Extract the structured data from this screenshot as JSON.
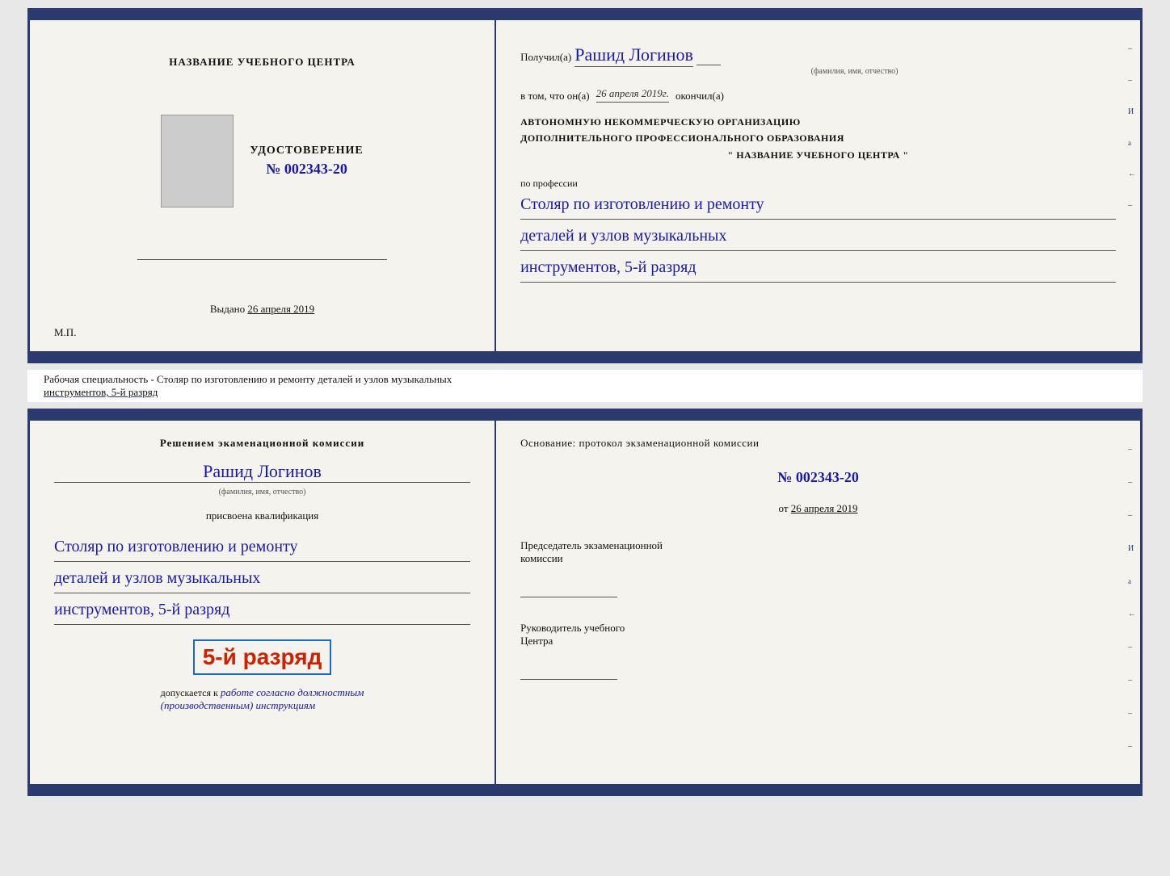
{
  "top_card": {
    "left": {
      "center_title": "НАЗВАНИЕ УЧЕБНОГО ЦЕНТРА",
      "photo_alt": "photo placeholder",
      "doc_type": "УДОСТОВЕРЕНИЕ",
      "doc_number": "№ 002343-20",
      "issued_label": "Выдано",
      "issued_date": "26 апреля 2019",
      "mp_label": "М.П."
    },
    "right": {
      "received_label": "Получил(а)",
      "person_name": "Рашид Логинов",
      "fio_subtitle": "(фамилия, имя, отчество)",
      "confirm_label": "в том, что он(а)",
      "date_handwritten": "26 апреля 2019г.",
      "finished_label": "окончил(а)",
      "org_line1": "АВТОНОМНУЮ НЕКОММЕРЧЕСКУЮ ОРГАНИЗАЦИЮ",
      "org_line2": "ДОПОЛНИТЕЛЬНОГО ПРОФЕССИОНАЛЬНОГО ОБРАЗОВАНИЯ",
      "org_quote_open": "\"",
      "org_name": "НАЗВАНИЕ УЧЕБНОГО ЦЕНТРА",
      "org_quote_close": "\"",
      "profession_label": "по профессии",
      "profession_line1": "Столяр по изготовлению и ремонту",
      "profession_line2": "деталей и узлов музыкальных",
      "profession_line3": "инструментов, 5-й разряд"
    }
  },
  "specialty_bar": {
    "text": "Рабочая специальность - Столяр по изготовлению и ремонту деталей и узлов музыкальных",
    "text2": "инструментов, 5-й разряд"
  },
  "bottom_card": {
    "left": {
      "decision_header": "Решением экаменационной комиссии",
      "person_name": "Рашид Логинов",
      "fio_subtitle": "(фамилия, имя, отчество)",
      "qualification_label": "присвоена квалификация",
      "qual_line1": "Столяр по изготовлению и ремонту",
      "qual_line2": "деталей и узлов музыкальных",
      "qual_line3": "инструментов, 5-й разряд",
      "rank_label": "5-й разряд",
      "admitted_label": "допускается к",
      "admitted_text": "работе согласно должностным",
      "admitted_text2": "(производственным) инструкциям"
    },
    "right": {
      "basis_label": "Основание: протокол экзаменационной комиссии",
      "protocol_number": "№  002343-20",
      "protocol_date_prefix": "от",
      "protocol_date": "26 апреля 2019",
      "chairman_title": "Председатель экзаменационной",
      "chairman_title2": "комиссии",
      "director_title": "Руководитель учебного",
      "director_title2": "Центра"
    }
  },
  "decoration": {
    "right_labels": [
      "И",
      "а",
      "←",
      "–",
      "–",
      "–",
      "–"
    ]
  }
}
